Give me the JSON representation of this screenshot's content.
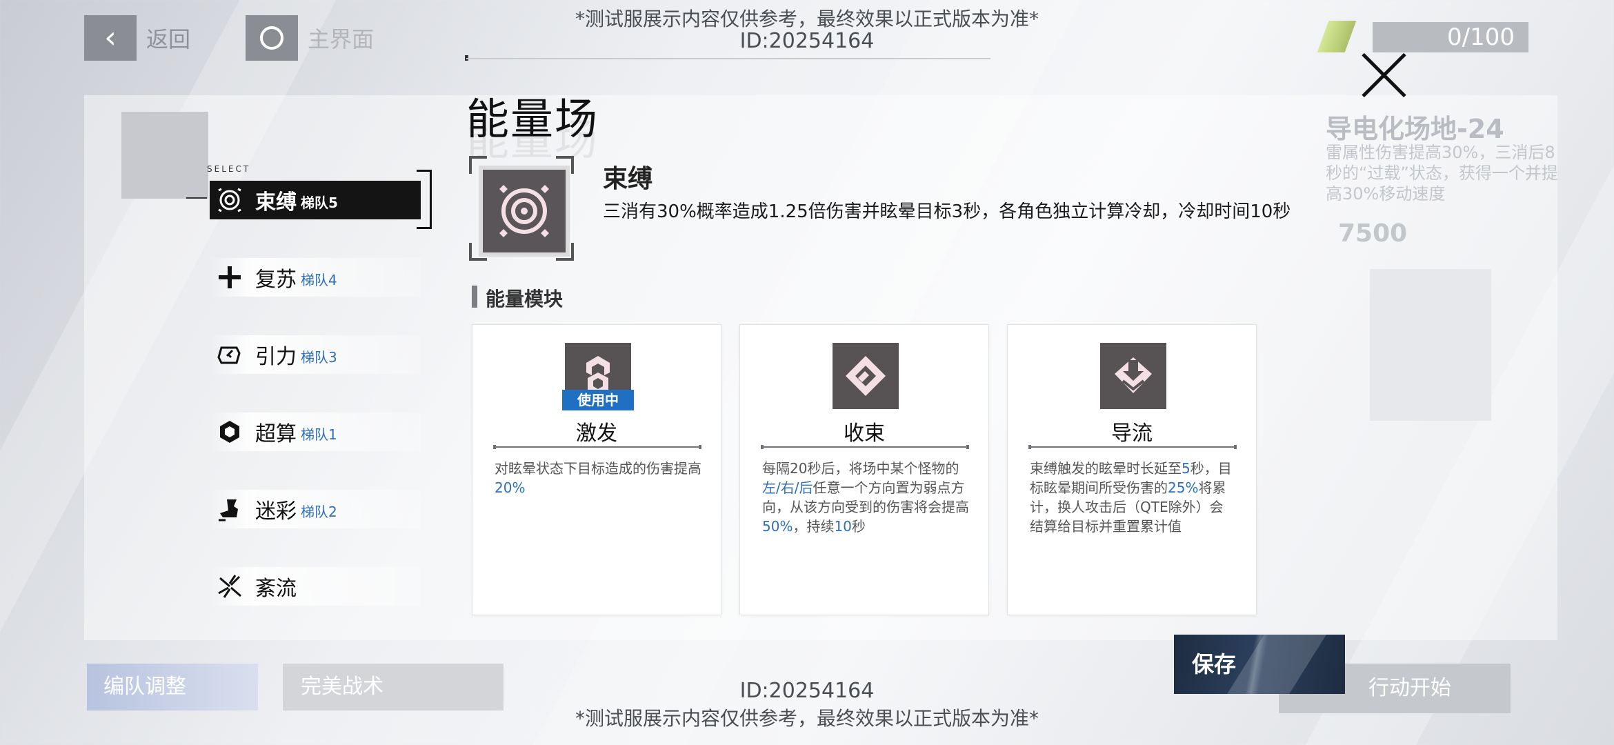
{
  "background": {
    "back_label": "返回",
    "home_label": "主界面",
    "counter": "0/100",
    "right_panel_title": "导电化场地-24",
    "right_panel_desc": "雷属性伤害提高30%，三消后8秒的“过载”状态，获得一个并提高30%移动速度",
    "right_panel_number": "7500",
    "bottom_btn_formation": "编队调整",
    "bottom_btn_tactics": "完美战术",
    "bottom_btn_start": "行动开始"
  },
  "notice": {
    "text": "*测试服展示内容仅供参考，最终效果以正式版本为准*",
    "id": "ID:20254164"
  },
  "modal": {
    "title": "能量场",
    "select_tag": "SELECT",
    "fields": [
      {
        "name": "束缚",
        "team": "梯队5",
        "icon": "target-icon",
        "active": true
      },
      {
        "name": "复苏",
        "team": "梯队4",
        "icon": "cross-icon",
        "active": false
      },
      {
        "name": "引力",
        "team": "梯队3",
        "icon": "gravity-icon",
        "active": false
      },
      {
        "name": "超算",
        "team": "梯队1",
        "icon": "cube-icon",
        "active": false
      },
      {
        "name": "迷彩",
        "team": "梯队2",
        "icon": "boot-icon",
        "active": false
      },
      {
        "name": "紊流",
        "team": "",
        "icon": "turbulence-icon",
        "active": false
      }
    ],
    "selected": {
      "name": "束缚",
      "icon": "target-icon",
      "description": "三消有30%概率造成1.25倍伤害并眩晕目标3秒，各角色独立计算冷却，冷却时间10秒"
    },
    "modules_label": "能量模块",
    "modules": [
      {
        "name": "激发",
        "icon": "burst-icon",
        "in_use": "使用中",
        "desc_parts": [
          "对眩晕状态下目标造成的伤害提高",
          "20%"
        ]
      },
      {
        "name": "收束",
        "icon": "converge-icon",
        "desc_parts": [
          "每隔20秒后，将场中某个怪物的",
          "左/右/后",
          "任意一个方向置为弱点方向，从该方向受到的伤害将会提高",
          "50%",
          "，持续",
          "10",
          "秒"
        ]
      },
      {
        "name": "导流",
        "icon": "diversion-icon",
        "desc_parts": [
          "束缚触发的眩晕时长延至",
          "5",
          "秒，目标眩晕期间所受伤害的",
          "25%",
          "将累计，换人攻击后（QTE除外）会结算给目标并重置累计值"
        ]
      }
    ],
    "save_label": "保存"
  },
  "colors": {
    "accent_blue": "#2d6fb8",
    "active_item": "#141414",
    "save_button": "#1e2c40"
  }
}
